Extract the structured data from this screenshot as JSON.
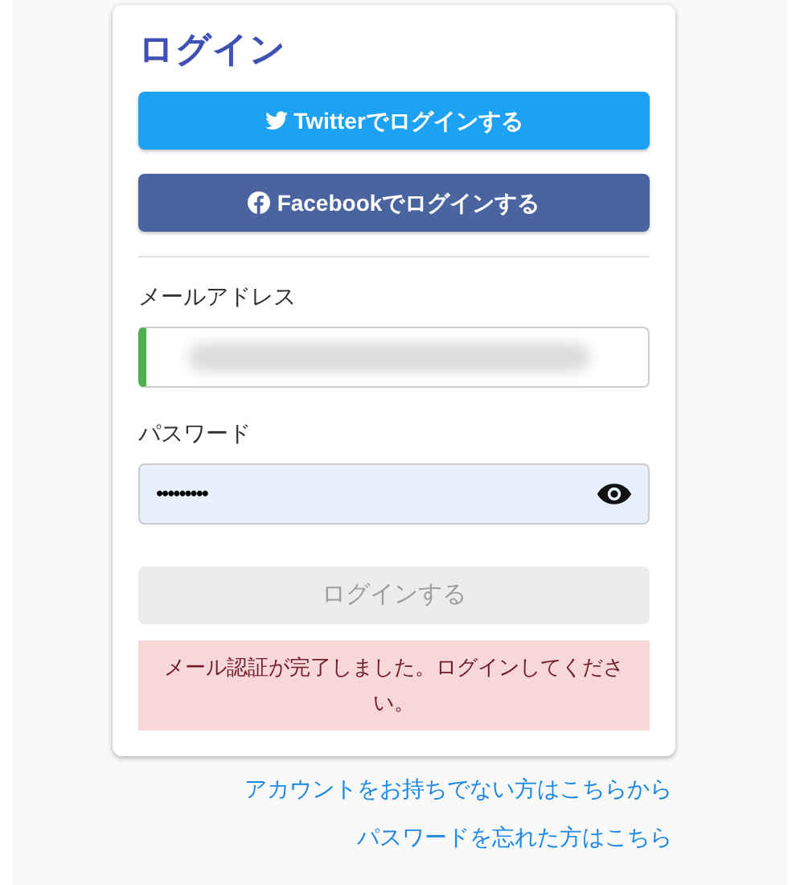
{
  "title": "ログイン",
  "social_buttons": [
    {
      "kind": "twitter",
      "label": "Twitterでログインする"
    },
    {
      "kind": "facebook",
      "label": "Facebookでログインする"
    }
  ],
  "email": {
    "label": "メールアドレス",
    "valid": true
  },
  "password": {
    "label": "パスワード",
    "value": "•••••••••",
    "autofilled": true
  },
  "submit": {
    "label": "ログインする",
    "disabled": true
  },
  "message": "メール認証が完了しました。ログインしてください。",
  "links": [
    "アカウントをお持ちでない方はこちらから",
    "パスワードを忘れた方はこちら"
  ]
}
